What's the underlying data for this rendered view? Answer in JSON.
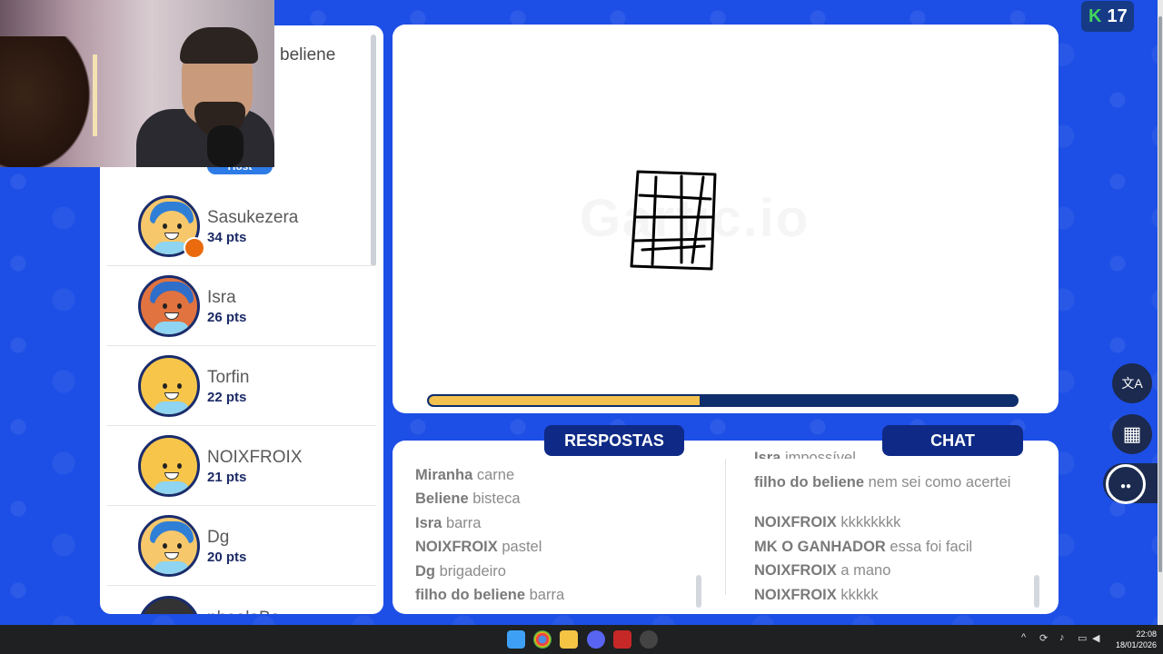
{
  "top_badge": {
    "icon": "k-logo-icon",
    "count": "17"
  },
  "players_panel": {
    "top_player_name": "beliene",
    "host_label": "Host",
    "players": [
      {
        "name": "Sasukezera",
        "points": "34 pts",
        "avatar_color": "#f7c86b",
        "hair_color": "#2f7fd7",
        "badge": true
      },
      {
        "name": "Isra",
        "points": "26 pts",
        "avatar_color": "#e0733f",
        "hair_color": "#2f6ec9",
        "badge": false
      },
      {
        "name": "Torfin",
        "points": "22 pts",
        "avatar_color": "#f7c54a",
        "hair_color": "#f7c54a",
        "badge": false
      },
      {
        "name": "NOIXFROIX",
        "points": "21 pts",
        "avatar_color": "#f7c54a",
        "hair_color": "#f7c54a",
        "badge": false
      },
      {
        "name": "Dg",
        "points": "20 pts",
        "avatar_color": "#f7c86b",
        "hair_color": "#2f7fd7",
        "badge": false
      }
    ],
    "partial_player_name": "phealaBa"
  },
  "canvas": {
    "watermark": "Gartic.io",
    "timer_progress": 0.46
  },
  "answers": {
    "title": "RESPOSTAS",
    "messages": [
      {
        "user": "Miranha",
        "text": "carne"
      },
      {
        "user": "Beliene",
        "text": "bisteca"
      },
      {
        "user": "Isra",
        "text": "barra"
      },
      {
        "user": "NOIXFROIX",
        "text": "pastel"
      },
      {
        "user": "Dg",
        "text": "brigadeiro"
      },
      {
        "user": "filho do beliene",
        "text": "barra"
      }
    ]
  },
  "chat": {
    "title": "CHAT",
    "partial_message": {
      "user": "Isra",
      "text": "impossível"
    },
    "messages": [
      {
        "user": "filho do beliene",
        "text": "nem sei como acertei"
      },
      {
        "user": "NOIXFROIX",
        "text": "kkkkkkkk"
      },
      {
        "user": "MK O GANHADOR",
        "text": "essa foi facil"
      },
      {
        "user": "NOIXFROIX",
        "text": "a mano"
      },
      {
        "user": "NOIXFROIX",
        "text": "kkkkk"
      }
    ]
  },
  "side_buttons": [
    {
      "icon": "translate-icon",
      "glyph": "文A"
    },
    {
      "icon": "grid-icon",
      "glyph": "▦"
    },
    {
      "icon": "gartic-face-icon",
      "glyph": "●●"
    }
  ],
  "taskbar": {
    "time": "22:08",
    "date": "18/01/2026"
  }
}
